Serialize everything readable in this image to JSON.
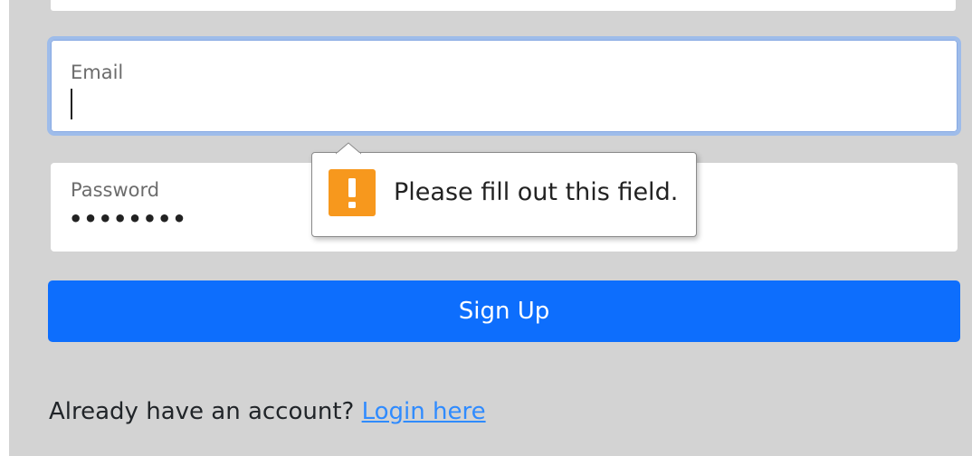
{
  "form": {
    "email": {
      "label": "Email",
      "value": ""
    },
    "password": {
      "label": "Password",
      "value": "••••••••"
    },
    "submit_label": "Sign Up",
    "footer": {
      "prompt": "Already have an account?",
      "link_label": "Login here"
    }
  },
  "validation_tooltip": {
    "message": "Please fill out this field.",
    "icon": "warning-icon"
  },
  "colors": {
    "primary": "#0d6efd",
    "link": "#2f8bff",
    "focus_ring": "#9ebcea",
    "warning": "#f7981d",
    "background": "#d3d3d3"
  }
}
